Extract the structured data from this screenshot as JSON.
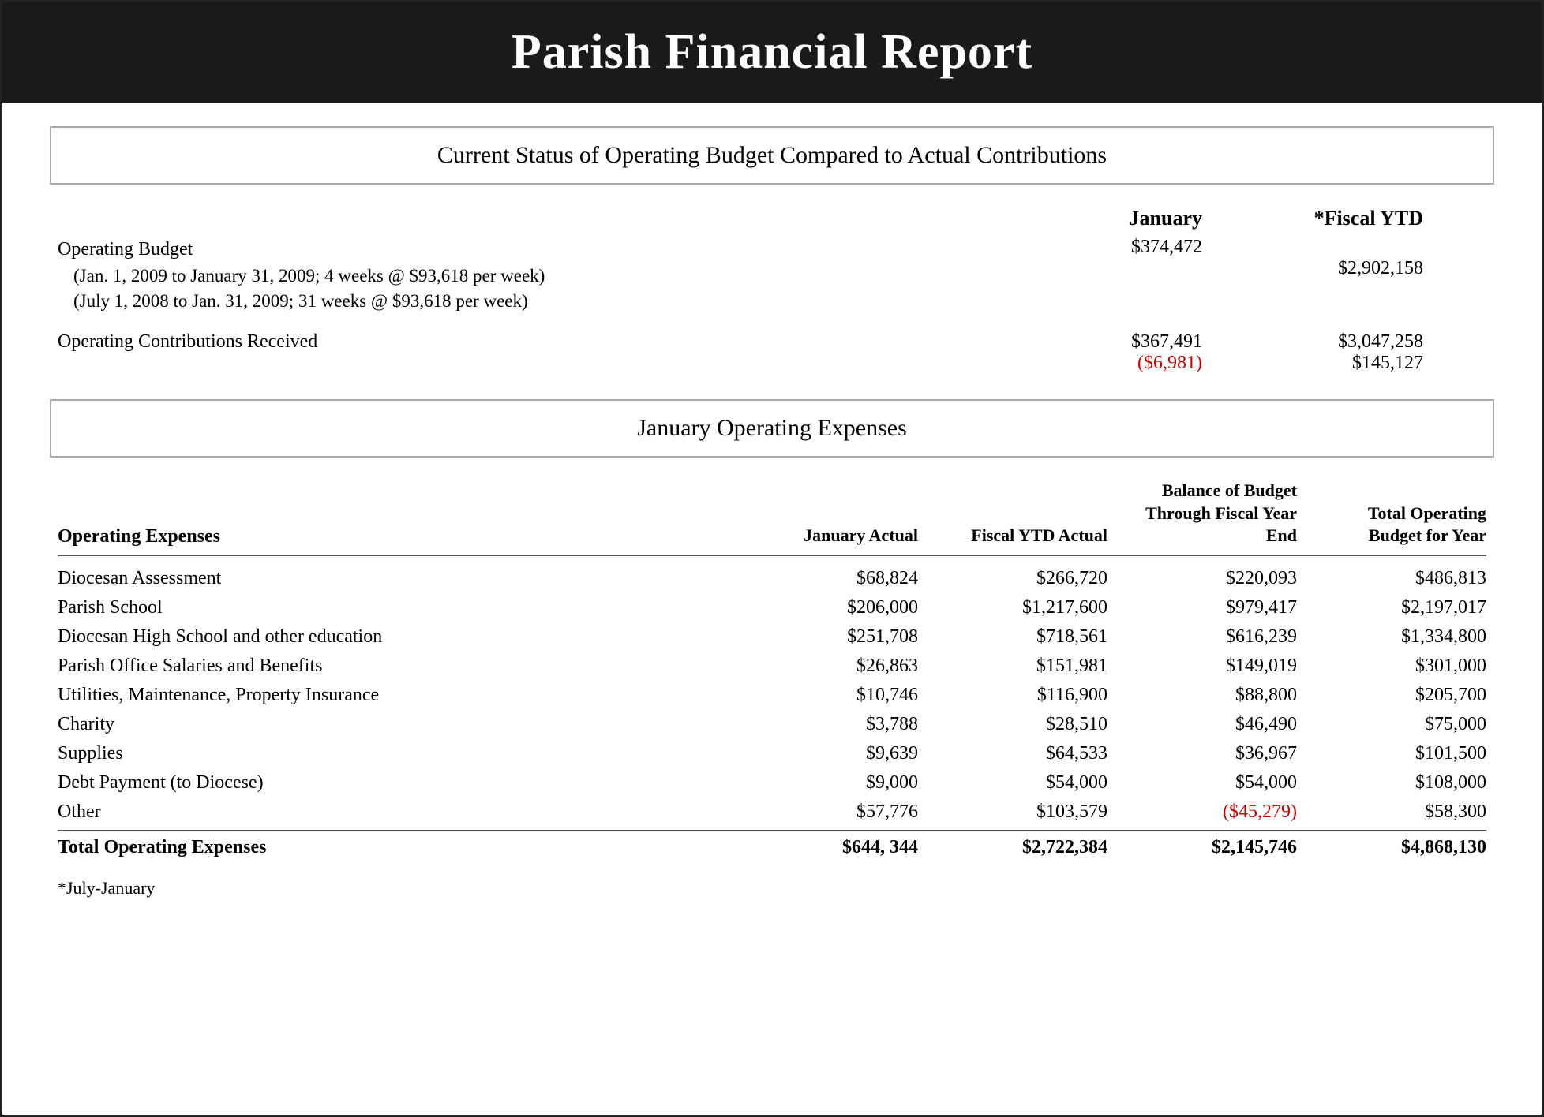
{
  "header": {
    "title": "Parish Financial Report"
  },
  "operating_budget_section": {
    "title": "Current Status of Operating Budget Compared to Actual Contributions",
    "col_headers": {
      "january": "January",
      "fiscal_ytd": "*Fiscal YTD"
    },
    "operating_budget_label": "Operating Budget",
    "jan_budget_desc": "(Jan. 1, 2009 to January 31, 2009; 4 weeks @ $93,618 per week)",
    "jan_budget_value": "$374,472",
    "ytd_budget_desc": "(July 1, 2008 to Jan. 31, 2009; 31 weeks @ $93,618 per week)",
    "ytd_budget_value": "$2,902,158",
    "contributions_label": "Operating Contributions Received",
    "contributions_jan": "$367,491",
    "contributions_jan_diff": "($6,981)",
    "contributions_ytd": "$3,047,258",
    "contributions_ytd_diff": "$145,127"
  },
  "expenses_section": {
    "title": "January Operating Expenses",
    "col_headers": {
      "label": "Operating Expenses",
      "jan_actual": "January Actual",
      "fiscal_ytd": "Fiscal YTD Actual",
      "balance": "Balance of Budget Through Fiscal Year End",
      "total_budget": "Total Operating Budget for Year"
    },
    "rows": [
      {
        "name": "Diocesan Assessment",
        "jan_actual": "$68,824",
        "fiscal_ytd": "$266,720",
        "balance": "$220,093",
        "total_budget": "$486,813",
        "balance_red": false
      },
      {
        "name": "Parish School",
        "jan_actual": "$206,000",
        "fiscal_ytd": "$1,217,600",
        "balance": "$979,417",
        "total_budget": "$2,197,017",
        "balance_red": false
      },
      {
        "name": "Diocesan High School and other education",
        "jan_actual": "$251,708",
        "fiscal_ytd": "$718,561",
        "balance": "$616,239",
        "total_budget": "$1,334,800",
        "balance_red": false
      },
      {
        "name": "Parish Office Salaries and Benefits",
        "jan_actual": "$26,863",
        "fiscal_ytd": "$151,981",
        "balance": "$149,019",
        "total_budget": "$301,000",
        "balance_red": false
      },
      {
        "name": "Utilities, Maintenance, Property Insurance",
        "jan_actual": "$10,746",
        "fiscal_ytd": "$116,900",
        "balance": "$88,800",
        "total_budget": "$205,700",
        "balance_red": false
      },
      {
        "name": "Charity",
        "jan_actual": "$3,788",
        "fiscal_ytd": "$28,510",
        "balance": "$46,490",
        "total_budget": "$75,000",
        "balance_red": false
      },
      {
        "name": "Supplies",
        "jan_actual": "$9,639",
        "fiscal_ytd": "$64,533",
        "balance": "$36,967",
        "total_budget": "$101,500",
        "balance_red": false
      },
      {
        "name": "Debt Payment (to Diocese)",
        "jan_actual": "$9,000",
        "fiscal_ytd": "$54,000",
        "balance": "$54,000",
        "total_budget": "$108,000",
        "balance_red": false
      },
      {
        "name": "Other",
        "jan_actual": "$57,776",
        "fiscal_ytd": "$103,579",
        "balance": "($45,279)",
        "total_budget": "$58,300",
        "balance_red": true
      }
    ],
    "totals": {
      "name": "Total Operating Expenses",
      "jan_actual": "$644, 344",
      "fiscal_ytd": "$2,722,384",
      "balance": "$2,145,746",
      "total_budget": "$4,868,130"
    }
  },
  "footnote": "*July-January"
}
